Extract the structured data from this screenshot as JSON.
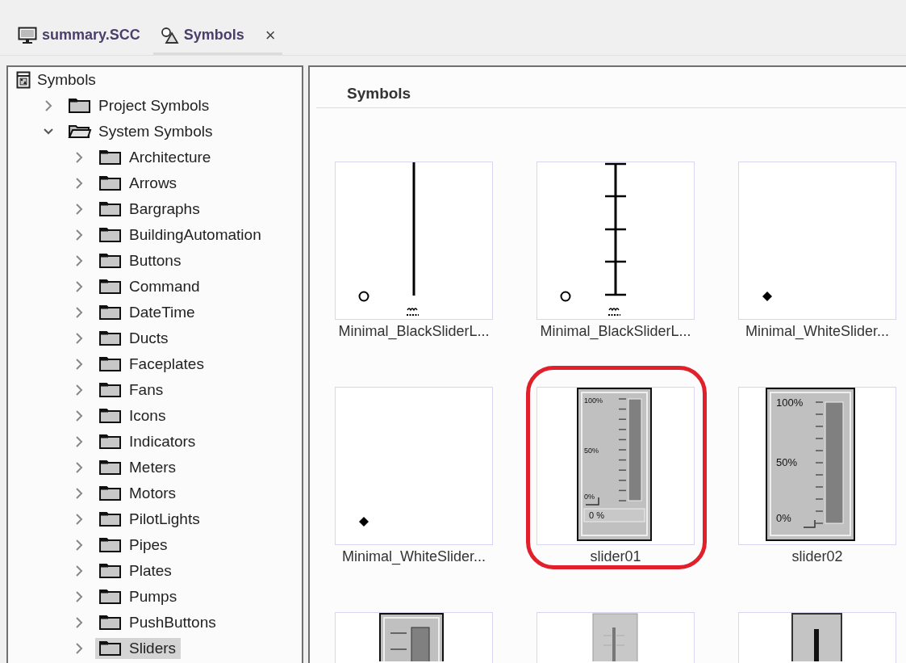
{
  "tabs": [
    {
      "label": "summary.SCC",
      "kind": "screen",
      "selected": false,
      "closable": false
    },
    {
      "label": "Symbols",
      "kind": "symbols",
      "selected": true,
      "closable": true,
      "close_glyph": "×"
    }
  ],
  "tree": [
    {
      "label": "Symbols",
      "kind": "root",
      "selected": false,
      "children": [
        {
          "label": "Project Symbols",
          "kind": "folder",
          "expanded": false,
          "selected": false
        },
        {
          "label": "System Symbols",
          "kind": "folder",
          "expanded": true,
          "selected": false,
          "children": [
            {
              "label": "Architecture",
              "kind": "folder",
              "expanded": false,
              "selected": false
            },
            {
              "label": "Arrows",
              "kind": "folder",
              "expanded": false,
              "selected": false
            },
            {
              "label": "Bargraphs",
              "kind": "folder",
              "expanded": false,
              "selected": false
            },
            {
              "label": "BuildingAutomation",
              "kind": "folder",
              "expanded": false,
              "selected": false
            },
            {
              "label": "Buttons",
              "kind": "folder",
              "expanded": false,
              "selected": false
            },
            {
              "label": "Command",
              "kind": "folder",
              "expanded": false,
              "selected": false
            },
            {
              "label": "DateTime",
              "kind": "folder",
              "expanded": false,
              "selected": false
            },
            {
              "label": "Ducts",
              "kind": "folder",
              "expanded": false,
              "selected": false
            },
            {
              "label": "Faceplates",
              "kind": "folder",
              "expanded": false,
              "selected": false
            },
            {
              "label": "Fans",
              "kind": "folder",
              "expanded": false,
              "selected": false
            },
            {
              "label": "Icons",
              "kind": "folder",
              "expanded": false,
              "selected": false
            },
            {
              "label": "Indicators",
              "kind": "folder",
              "expanded": false,
              "selected": false
            },
            {
              "label": "Meters",
              "kind": "folder",
              "expanded": false,
              "selected": false
            },
            {
              "label": "Motors",
              "kind": "folder",
              "expanded": false,
              "selected": false
            },
            {
              "label": "PilotLights",
              "kind": "folder",
              "expanded": false,
              "selected": false
            },
            {
              "label": "Pipes",
              "kind": "folder",
              "expanded": false,
              "selected": false
            },
            {
              "label": "Plates",
              "kind": "folder",
              "expanded": false,
              "selected": false
            },
            {
              "label": "Pumps",
              "kind": "folder",
              "expanded": false,
              "selected": false
            },
            {
              "label": "PushButtons",
              "kind": "folder",
              "expanded": false,
              "selected": false
            },
            {
              "label": "Sliders",
              "kind": "folder",
              "expanded": false,
              "selected": true
            }
          ]
        }
      ]
    }
  ],
  "panel": {
    "title": "Symbols"
  },
  "symbols": [
    {
      "label": "Minimal_BlackSliderL...",
      "kind": "black-line",
      "highlighted": false
    },
    {
      "label": "Minimal_BlackSliderL...",
      "kind": "black-ticks",
      "highlighted": false
    },
    {
      "label": "Minimal_WhiteSlider...",
      "kind": "white-dot",
      "highlighted": false
    },
    {
      "label": "Minimal_WhiteSlider...",
      "kind": "white-dot",
      "highlighted": false
    },
    {
      "label": "slider01",
      "kind": "slider-readout",
      "highlighted": true,
      "scale": [
        "100%",
        "50%",
        "0%"
      ],
      "readout": "0 %"
    },
    {
      "label": "slider02",
      "kind": "slider-large",
      "highlighted": false,
      "scale": [
        "100%",
        "50%",
        "0%"
      ]
    },
    {
      "kind": "bar-small",
      "highlighted": false
    },
    {
      "kind": "slider-thin",
      "highlighted": false
    },
    {
      "kind": "slider-black",
      "highlighted": false
    }
  ]
}
